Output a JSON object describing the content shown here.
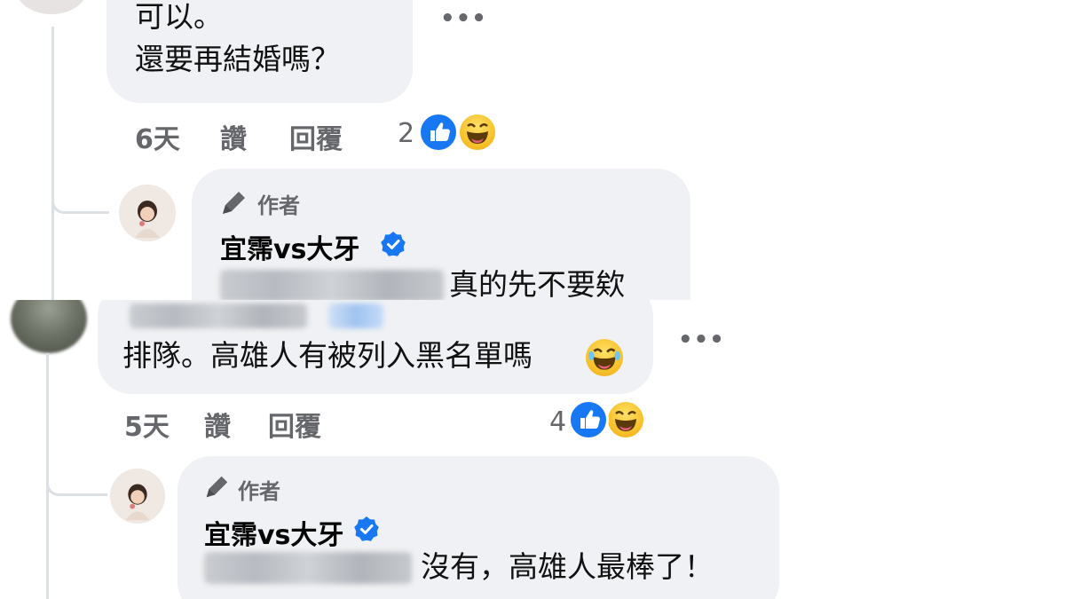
{
  "comment1": {
    "text_line1": "可以。",
    "text_line2": "還要再結婚嗎？",
    "more_label": "•••",
    "time": "6天",
    "like_label": "讚",
    "reply_label": "回覆",
    "reaction_count": "2",
    "reactions": [
      "like-icon",
      "laughing-face-icon"
    ]
  },
  "reply1": {
    "author_tag": "作者",
    "author_name": "宜霈vs大牙",
    "text": "真的先不要欸",
    "verified": true
  },
  "comment2": {
    "text": "排隊。高雄人有被列入黑名單嗎",
    "inline_emoji": "laughing-face-icon",
    "more_label": "•••",
    "time": "5天",
    "like_label": "讚",
    "reply_label": "回覆",
    "reaction_count": "4",
    "reactions": [
      "like-icon",
      "laughing-face-icon"
    ]
  },
  "reply2": {
    "author_tag": "作者",
    "author_name": "宜霈vs大牙",
    "text": "沒有，高雄人最棒了！",
    "verified": true
  },
  "colors": {
    "bubble": "#eff1f4",
    "meta_text": "#65676b",
    "like_blue": "#1877f2",
    "verified_blue": "#1877f2",
    "thread_line": "#dcdfe3"
  }
}
